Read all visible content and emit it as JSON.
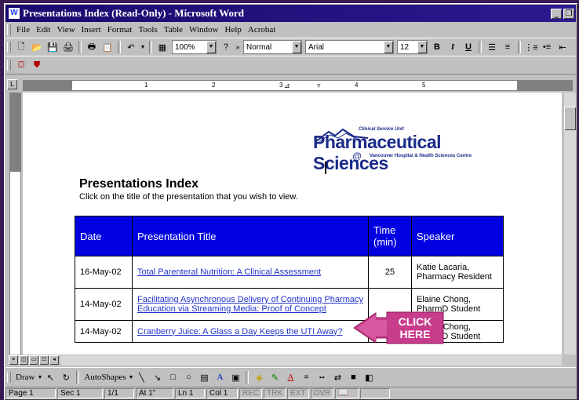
{
  "window": {
    "title": "Presentations Index (Read-Only) - Microsoft Word"
  },
  "menu": [
    "File",
    "Edit",
    "View",
    "Insert",
    "Format",
    "Tools",
    "Table",
    "Window",
    "Help",
    "Acrobat"
  ],
  "toolbar": {
    "zoom": "100%",
    "style": "Normal",
    "font": "Arial",
    "size": "12",
    "bold": "B",
    "italic": "I",
    "underline": "U"
  },
  "ruler": {
    "numbers": [
      "1",
      "2",
      "3",
      "4",
      "5"
    ]
  },
  "logo": {
    "tagline": "Clinical Service Unit",
    "name": "Pharmaceutical Sciences",
    "at": "@",
    "site": "Vancouver Hospital & Health Sciences Centre"
  },
  "document": {
    "heading": "Presentations Index",
    "instruction": "Click on the title of the presentation that you wish to view.",
    "table": {
      "headers": [
        "Date",
        "Presentation Title",
        "Time (min)",
        "Speaker"
      ],
      "rows": [
        {
          "date": "16-May-02",
          "title": "Total Parenteral Nutrition: A Clinical Assessment",
          "time": "25",
          "speaker": "Katie Lacaria, Pharmacy Resident"
        },
        {
          "date": "14-May-02",
          "title": "Facilitating Asynchronous Delivery of Continuing Pharmacy Education via Streaming Media: Proof of Concept",
          "time": "",
          "speaker": "Elaine Chong, PharmD Student"
        },
        {
          "date": "14-May-02",
          "title": "Cranberry Juice: A Glass a Day Keeps the UTI Away?",
          "time": "",
          "speaker": "Elaine Chong, PharmD Student"
        }
      ]
    }
  },
  "callout": {
    "line1": "CLICK",
    "line2": "HERE"
  },
  "drawbar": {
    "draw": "Draw",
    "autoshapes": "AutoShapes"
  },
  "status": {
    "page": "Page 1",
    "sec": "Sec 1",
    "pages": "1/1",
    "at": "At 1\"",
    "ln": "Ln 1",
    "col": "Col 1",
    "rec": "REC",
    "trk": "TRK",
    "ext": "EXT",
    "ovr": "OVR"
  }
}
